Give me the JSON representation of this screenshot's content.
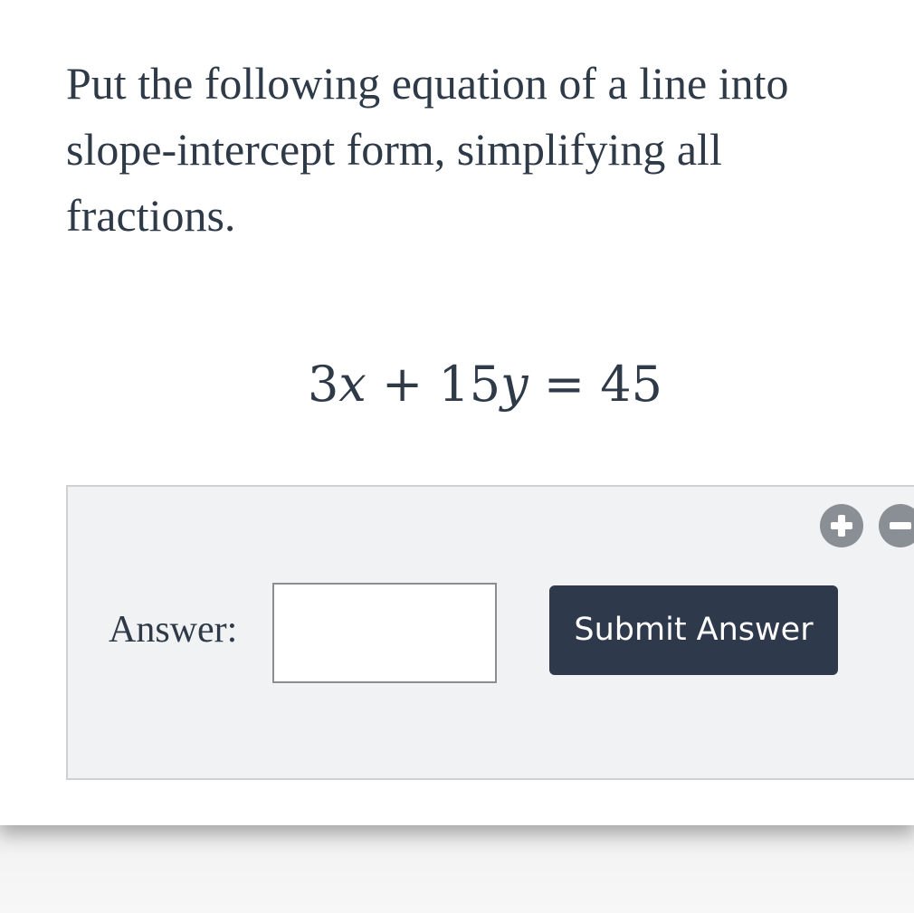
{
  "question": {
    "prompt": "Put the following equation of a line into slope-intercept form, simplifying all fractions.",
    "equation": {
      "coef_x": "3",
      "var_x": "x",
      "plus": "+",
      "coef_y": "15",
      "var_y": "y",
      "equals": "=",
      "rhs": "45"
    }
  },
  "answer_panel": {
    "zoom_in_icon": "plus-circle-icon",
    "zoom_out_icon": "minus-circle-icon",
    "label": "Answer:",
    "input_value": "",
    "submit_label": "Submit Answer"
  },
  "colors": {
    "text": "#2f3a48",
    "panel_bg": "#f1f2f3",
    "button_bg": "#2e3a4c",
    "icon_gray": "#8a8f95"
  }
}
